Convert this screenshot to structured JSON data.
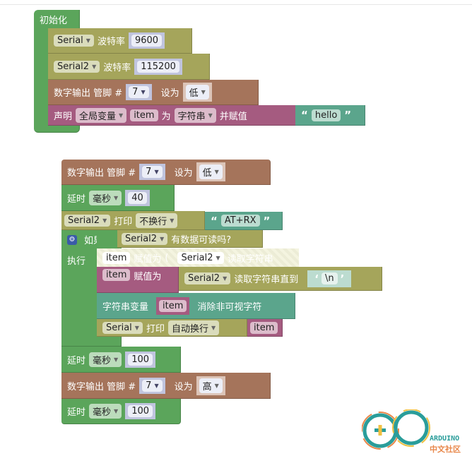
{
  "setup": {
    "title": "初始化",
    "serial1": {
      "port": "Serial",
      "label": "波特率",
      "baud": "9600"
    },
    "serial2": {
      "port": "Serial2",
      "label": "波特率",
      "baud": "115200"
    },
    "digital": {
      "label": "数字输出 管脚 #",
      "pin": "7",
      "set": "设为",
      "value": "低"
    },
    "declare": {
      "label": "声明",
      "scope": "全局变量",
      "var": "item",
      "as": "为",
      "type": "字符串",
      "assign": "并赋值",
      "value": "hello"
    }
  },
  "loop": {
    "digital1": {
      "label": "数字输出 管脚 #",
      "pin": "7",
      "set": "设为",
      "value": "低"
    },
    "delay1": {
      "label": "延时",
      "unit": "毫秒",
      "value": "40"
    },
    "print1": {
      "port": "Serial2",
      "label": "打印",
      "mode": "不换行",
      "value": "AT+RX"
    },
    "if": {
      "label": "如果",
      "port": "Serial2",
      "cond": "有数据可读吗?",
      "do": "执行",
      "disabled": {
        "var": "item",
        "assign": "赋值为",
        "port": "Serial2",
        "op": "读取字符串"
      },
      "assign": {
        "var": "item",
        "assign": "赋值为",
        "port": "Serial2",
        "op": "读取字符串直到",
        "value": "\\n"
      },
      "trim": {
        "label": "字符串变量",
        "var": "item",
        "op": "消除非可视字符"
      },
      "print": {
        "port": "Serial",
        "label": "打印",
        "mode": "自动换行",
        "var": "item"
      }
    },
    "delay2": {
      "label": "延时",
      "unit": "毫秒",
      "value": "100"
    },
    "digital2": {
      "label": "数字输出 管脚 #",
      "pin": "7",
      "set": "设为",
      "value": "高"
    },
    "delay3": {
      "label": "延时",
      "unit": "毫秒",
      "value": "100"
    }
  },
  "logo": {
    "text1": "ARDUINO",
    "text2": "中文社区"
  },
  "colors": {
    "loop_green": "#5ba55b",
    "serial_olive": "#a5a55b",
    "io_brown": "#a5745b",
    "var_purple": "#a55b80",
    "text_teal": "#5ba58c"
  }
}
